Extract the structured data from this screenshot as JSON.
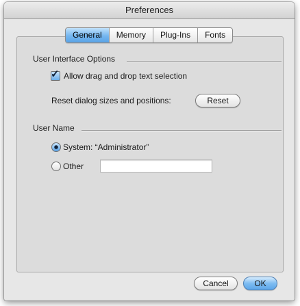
{
  "window": {
    "title": "Preferences"
  },
  "tabs": [
    {
      "label": "General",
      "selected": true
    },
    {
      "label": "Memory",
      "selected": false
    },
    {
      "label": "Plug-Ins",
      "selected": false
    },
    {
      "label": "Fonts",
      "selected": false
    }
  ],
  "ui_options": {
    "title": "User Interface Options",
    "drag_drop_label": "Allow drag and drop text selection",
    "drag_drop_checked": true,
    "reset_label": "Reset dialog sizes and positions:",
    "reset_button": "Reset"
  },
  "user_name": {
    "title": "User Name",
    "system_label": "System: “Administrator”",
    "system_selected": true,
    "other_label": "Other",
    "other_value": ""
  },
  "footer": {
    "cancel_label": "Cancel",
    "ok_label": "OK"
  },
  "colors": {
    "accent": "#6aaeea",
    "window_bg": "#e7e7e7"
  }
}
